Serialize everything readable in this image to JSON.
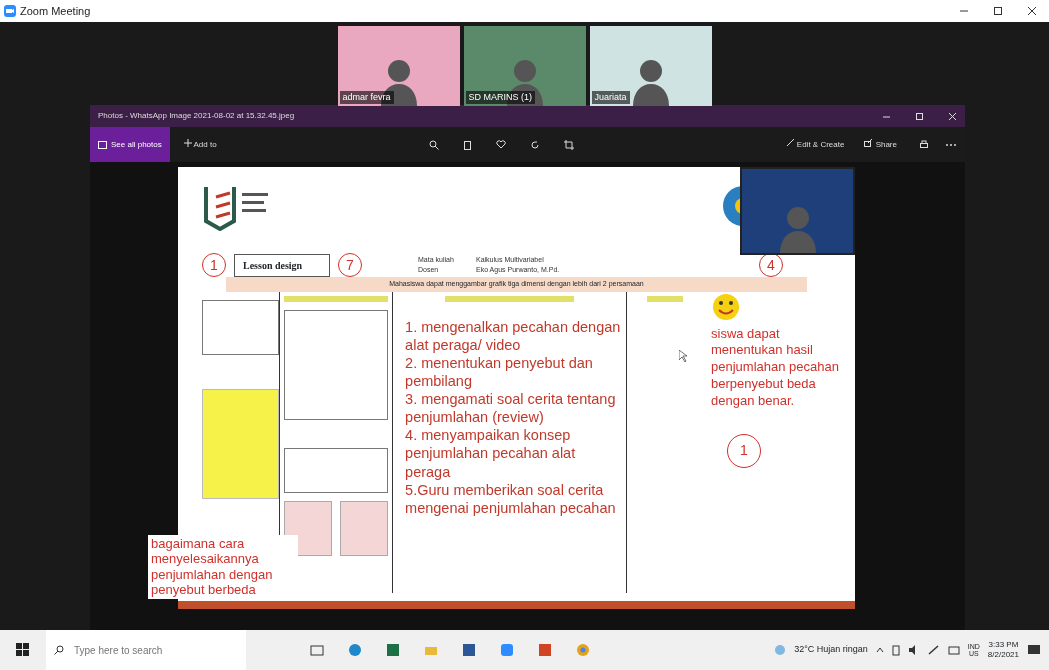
{
  "window": {
    "title": "Zoom Meeting"
  },
  "participants": [
    {
      "name": "admar fevra"
    },
    {
      "name": "SD MARINS (1)"
    },
    {
      "name": "Juariata"
    }
  ],
  "photos": {
    "title": "Photos - WhatsApp Image 2021-08-02 at 15.32.45.jpeg",
    "see_all": "See all photos",
    "add_to": "Add to",
    "edit_create": "Edit & Create",
    "share": "Share"
  },
  "slide": {
    "lesson_label": "Lesson design",
    "info": [
      {
        "label": "Mata kuliah",
        "value": "Kalkulus Multivariabel"
      },
      {
        "label": "Dosen",
        "value": "Eko Agus Purwanto, M.Pd."
      }
    ],
    "objective": "Mahasiswa dapat menggambar grafik tiga dimensi dengan lebih dari 2 persamaan",
    "steps": [
      "1. mengenalkan pecahan dengan alat peraga/ video",
      "2. menentukan penyebut dan pembilang",
      "3. mengamati soal cerita tentang penjumlahan (review)",
      "4. menyampaikan konsep penjumlahan pecahan alat peraga",
      "5.Guru memberikan soal cerita mengenai penjumlahan pecahan"
    ],
    "right_note": "siswa dapat menentukan hasil penjumlahan pecahan berpenyebut beda dengan benar.",
    "left_note": "bagaimana cara menyelesaikannya penjumlahan dengan penyebut berbeda",
    "circled_marks": [
      "1",
      "7",
      "4",
      "1"
    ]
  },
  "taskbar": {
    "search_placeholder": "Type here to search",
    "weather": "32°C Hujan ringan",
    "lang_top": "IND",
    "lang_bottom": "US",
    "time": "3:33 PM",
    "date": "8/2/2021"
  }
}
